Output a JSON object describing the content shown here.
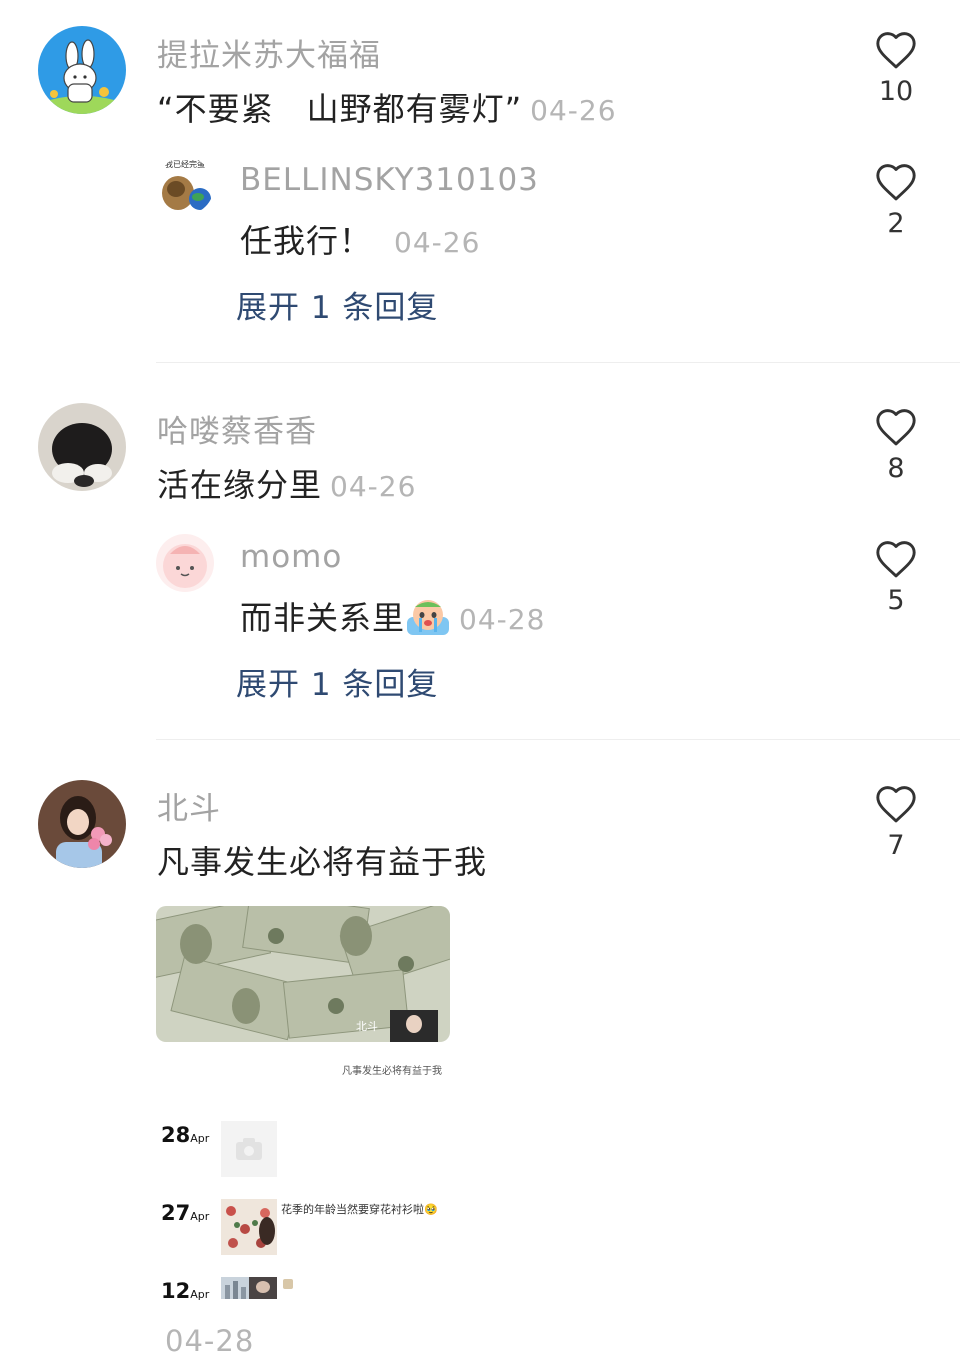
{
  "comments": [
    {
      "username": "提拉米苏大福福",
      "text": "“不要紧　山野都有雾灯”",
      "date": "04-26",
      "likes": "10",
      "reply": {
        "username": "BELLINSKY310103",
        "avatar_text": "我已经完蛋",
        "text": "任我行！",
        "date": "04-26",
        "likes": "2"
      },
      "expand_label": "展开 1 条回复"
    },
    {
      "username": "哈喽蔡香香",
      "text": "活在缘分里",
      "date": "04-26",
      "likes": "8",
      "reply": {
        "username": "momo",
        "text": "而非关系里",
        "emoji": "crying-emoji",
        "date": "04-28",
        "likes": "5"
      },
      "expand_label": "展开 1 条回复"
    },
    {
      "username": "北斗",
      "text": "凡事发生必将有益于我",
      "likes": "7",
      "attachment": {
        "overlay_label": "北斗",
        "caption": "凡事发生必将有益于我",
        "timeline": [
          {
            "day": "28",
            "month": "Apr",
            "thumb": "camera-icon"
          },
          {
            "day": "27",
            "month": "Apr",
            "thumb": "floral-photo",
            "text": "花季的年龄当然要穿花衬衫啦🥹"
          },
          {
            "day": "12",
            "month": "Apr",
            "thumb": "city-photo"
          }
        ]
      },
      "date": "04-28"
    }
  ],
  "colors": {
    "username": "#a3a3a3",
    "date": "#b5b5b5",
    "expand_link": "#2f4a72",
    "text": "#222222",
    "divider": "#eeeeee"
  },
  "icons": {
    "like": "heart-outline-icon"
  }
}
